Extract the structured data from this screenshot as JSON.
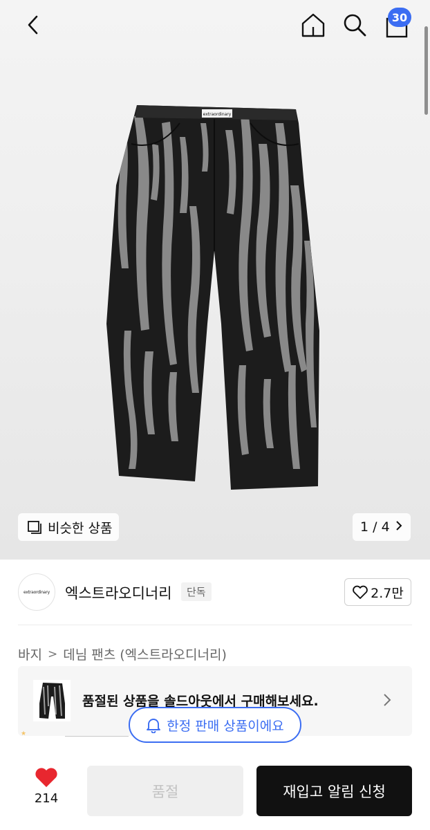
{
  "header": {
    "cart_count": "30"
  },
  "gallery": {
    "similar_label": "비슷한 상품",
    "pager": "1 / 4",
    "image_label": "extraordinary"
  },
  "brand": {
    "logo_text": "extraordinary",
    "name": "엑스트라오디너리",
    "tag": "단독",
    "likes": "2.7만"
  },
  "breadcrumb": {
    "category": "바지",
    "subcategory": "데님 팬츠 (엑스트라오디너리)"
  },
  "banner": {
    "text": "품절된 상품을 솔드아웃에서 구매해보세요."
  },
  "limited_badge": "한정 판매 상품이에요",
  "bottom": {
    "wish_count": "214",
    "soldout_label": "품절",
    "restock_label": "재입고 알림 신청"
  },
  "colors": {
    "accent": "#3b6df2",
    "heart": "#e8272f",
    "primary_button": "#111111"
  }
}
